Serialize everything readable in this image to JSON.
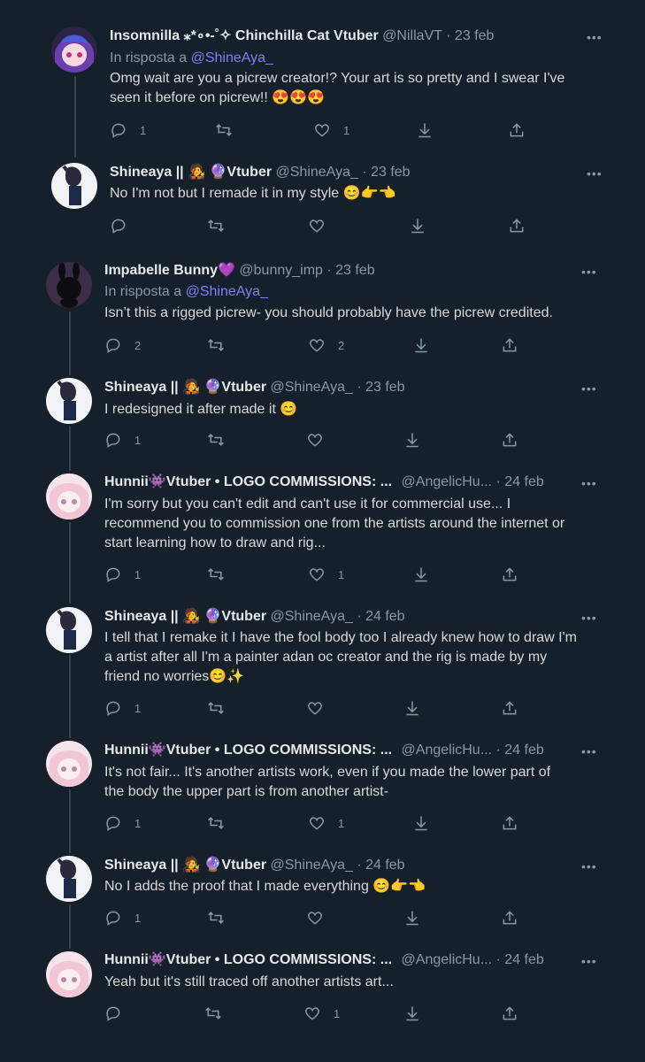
{
  "tweets": [
    {
      "name": "Insomnilla ⁎*∘•-˚✧ Chinchilla Cat Vtuber",
      "handle": "@NillaVT",
      "date": "23 feb",
      "reply_prefix": "In risposta a",
      "reply_mention": "@ShineAya_",
      "text_lines": [
        "Omg wait are you a picrew creator!? Your art is so pretty and I swear I've",
        "seen it before on picrew!! 😍😍😍"
      ],
      "reply_count": "1",
      "like_count": "1",
      "avatar_color": "#7f4fb0"
    },
    {
      "name": "Shineaya || 🧑‍🎤 🔮Vtuber",
      "handle": "@ShineAya_",
      "date": "23 feb",
      "text_lines": [
        "No I'm not but I remade it in my style 😊👉👈"
      ],
      "reply_count": "",
      "like_count": "",
      "avatar_color": "#eef0f5"
    },
    {
      "name": "Impabelle Bunny💜",
      "handle": "@bunny_imp",
      "date": "23 feb",
      "reply_prefix": "In risposta a",
      "reply_mention": "@ShineAya_",
      "text_lines": [
        "Isn’t this a rigged picrew- you should probably have the picrew credited."
      ],
      "reply_count": "2",
      "like_count": "2",
      "avatar_color": "#3a2b44"
    },
    {
      "name": "Shineaya || 🧑‍🎤 🔮Vtuber",
      "handle": "@ShineAya_",
      "date": "23 feb",
      "text_lines": [
        "I redesigned it after made it 😊"
      ],
      "reply_count": "1",
      "like_count": "",
      "avatar_color": "#eef0f5"
    },
    {
      "name": "Hunnii👾Vtuber • LOGO COMMISSIONS: ...",
      "handle": "@AngelicHu...",
      "date": "24 feb",
      "text_lines": [
        "I'm sorry but you can't edit and can't use it for commercial use... I",
        "recommend you to commission one from the artists around the internet or",
        "start learning how to draw and rig..."
      ],
      "reply_count": "1",
      "like_count": "1",
      "avatar_color": "#f2d6df"
    },
    {
      "name": "Shineaya || 🧑‍🎤 🔮Vtuber",
      "handle": "@ShineAya_",
      "date": "24 feb",
      "text_lines": [
        "I tell that I remake it I have the fool body too I already knew how to draw I'm",
        "a artist after all I'm a painter adan oc creator and the rig is made by my",
        "friend no worries😊✨"
      ],
      "reply_count": "1",
      "like_count": "",
      "avatar_color": "#eef0f5"
    },
    {
      "name": "Hunnii👾Vtuber • LOGO COMMISSIONS: ...",
      "handle": "@AngelicHu...",
      "date": "24 feb",
      "text_lines": [
        "It's not fair... It's another artists work, even if you made the lower part of",
        "the body the upper part is from another artist-"
      ],
      "reply_count": "1",
      "like_count": "1",
      "avatar_color": "#f2d6df"
    },
    {
      "name": "Shineaya || 🧑‍🎤 🔮Vtuber",
      "handle": "@ShineAya_",
      "date": "24 feb",
      "text_lines": [
        "No I adds the proof that I made everything 😊👉👈"
      ],
      "reply_count": "1",
      "like_count": "",
      "avatar_color": "#eef0f5"
    },
    {
      "name": "Hunnii👾Vtuber • LOGO COMMISSIONS: ...",
      "handle": "@AngelicHu...",
      "date": "24 feb",
      "text_lines": [
        "Yeah but it's still traced off another artists art..."
      ],
      "reply_count": "",
      "like_count": "1",
      "avatar_color": "#f2d6df"
    }
  ],
  "separator": "·",
  "colors": {
    "background": "#15202b",
    "text": "#d9d9d9",
    "muted": "#8899a6",
    "mention": "#8a7cf5",
    "line": "#38444d"
  }
}
